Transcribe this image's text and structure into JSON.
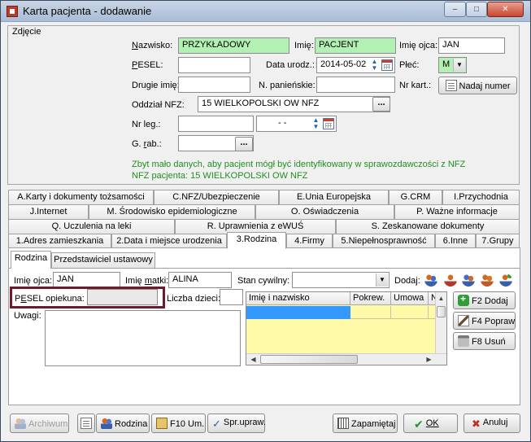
{
  "window": {
    "title": "Karta pacjenta - dodawanie",
    "controls": {
      "minimize": "–",
      "maximize": "□",
      "close": "✕"
    }
  },
  "photo": {
    "label": "Zdjęcie"
  },
  "form": {
    "nazwisko": {
      "label": "Nazwisko:",
      "value": "PRZYKŁADOWY"
    },
    "imie": {
      "label": "Imię:",
      "value": "PACJENT"
    },
    "imie_ojca": {
      "label": "Imię ojca:",
      "value": "JAN"
    },
    "pesel": {
      "label": "PESEL:",
      "value": ""
    },
    "data_urodz": {
      "label": "Data urodz.:",
      "value": "2014-05-02"
    },
    "plec": {
      "label": "Płeć:",
      "value": "M"
    },
    "drugie_imie": {
      "label": "Drugie imię:",
      "value": ""
    },
    "nr_panienskie": {
      "label": "N. panieńskie:",
      "value": ""
    },
    "nr_kart": {
      "label": "Nr kart.:",
      "value": ""
    },
    "nadaj_numer": "Nadaj numer",
    "oddzial_nfz": {
      "label": "Oddział NFZ:",
      "value": "15 WIELKOPOLSKI OW NFZ",
      "button": "..."
    },
    "nr_leg": {
      "label": "Nr leg.:",
      "value": "",
      "date_value": "- -"
    },
    "g_rab": {
      "label": "G. rab.:",
      "value": "",
      "button": "..."
    },
    "note_line1": "Zbyt mało danych, aby pacjent mógł być identyfikowany w sprawozdawczości z NFZ",
    "note_line2": "NFZ pacjenta: 15 WIELKOPOLSKI OW NFZ"
  },
  "tabs": {
    "row1": [
      "A.Karty i dokumenty tożsamości",
      "C.NFZ/Ubezpieczenie",
      "E.Unia Europejska",
      "G.CRM",
      "I.Przychodnia"
    ],
    "row2": [
      "J.Internet",
      "M. Środowisko epidemiologiczne",
      "O. Oświadczenia",
      "P. Ważne informacje"
    ],
    "row3": [
      "Q. Uczulenia na leki",
      "R. Uprawnienia z eWUŚ",
      "S. Zeskanowane dokumenty"
    ],
    "row4": [
      "1.Adres zamieszkania",
      "2.Data i miejsce urodzenia",
      "3.Rodzina",
      "4.Firmy",
      "5.Niepełnosprawność",
      "6.Inne",
      "7.Grupy"
    ]
  },
  "subtabs": [
    "Rodzina",
    "Przedstawiciel ustawowy"
  ],
  "rodzina": {
    "imie_ojca": {
      "label": "Imię ojca:",
      "value": "JAN"
    },
    "imie_matki": {
      "label": "Imię matki:",
      "value": "ALINA"
    },
    "stan_cywilny": {
      "label": "Stan cywilny:",
      "value": ""
    },
    "dodaj": "Dodaj:",
    "pesel_opiekuna": {
      "label": "PESEL opiekuna:",
      "value": ""
    },
    "liczba_dzieci": {
      "label": "Liczba dzieci:",
      "value": ""
    },
    "uwagi": {
      "label": "Uwagi:",
      "value": ""
    },
    "grid": {
      "columns": [
        "Imię i nazwisko",
        "Pokrew.",
        "Umowa",
        "N"
      ]
    },
    "f2": "F2 Dodaj",
    "f4": "F4 Popraw",
    "f8": "F8 Usuń"
  },
  "bottom": {
    "archiwum": "Archiwum",
    "rodzina": "Rodzina",
    "f10": "F10 Um.",
    "spr": "Spr.upraw.",
    "zapamietaj": "Zapamiętaj",
    "ok": "OK",
    "anuluj": "Anuluj"
  }
}
